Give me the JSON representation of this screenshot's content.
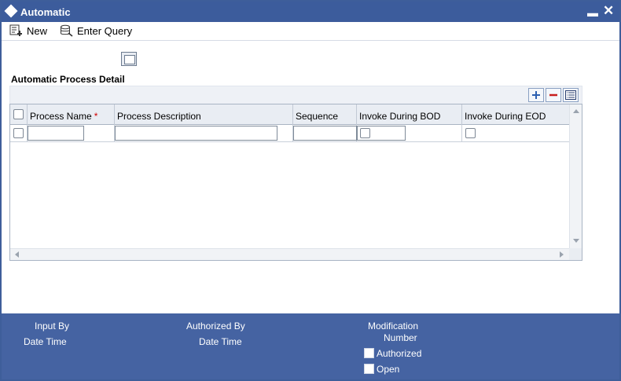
{
  "window": {
    "title": "Automatic",
    "minimize_glyph": "▬",
    "close_glyph": "✕"
  },
  "toolbar": {
    "new_label": "New",
    "enter_query_label": "Enter Query"
  },
  "section": {
    "title": "Automatic Process Detail"
  },
  "grid": {
    "columns": [
      {
        "label": "Process Name",
        "required_mark": "*"
      },
      {
        "label": "Process Description"
      },
      {
        "label": "Sequence"
      },
      {
        "label": "Invoke During BOD"
      },
      {
        "label": "Invoke During EOD"
      }
    ],
    "rows": [
      {
        "process_name": "",
        "process_description": "",
        "sequence": "",
        "invoke_bod": false,
        "invoke_eod": false
      }
    ]
  },
  "footer": {
    "input_by": "Input By",
    "input_date_time": "Date Time",
    "authorized_by": "Authorized By",
    "authorized_date_time": "Date Time",
    "modification": "Modification",
    "number": "Number",
    "authorized_label": "Authorized",
    "open_label": "Open"
  },
  "colors": {
    "titlebar": "#3c5c9c",
    "footer": "#4563a2",
    "required": "#d10000"
  },
  "icons": [
    "app-logo-icon",
    "new-record-icon",
    "enter-query-icon",
    "panel-icon",
    "add-row-icon",
    "delete-row-icon",
    "single-view-icon"
  ]
}
